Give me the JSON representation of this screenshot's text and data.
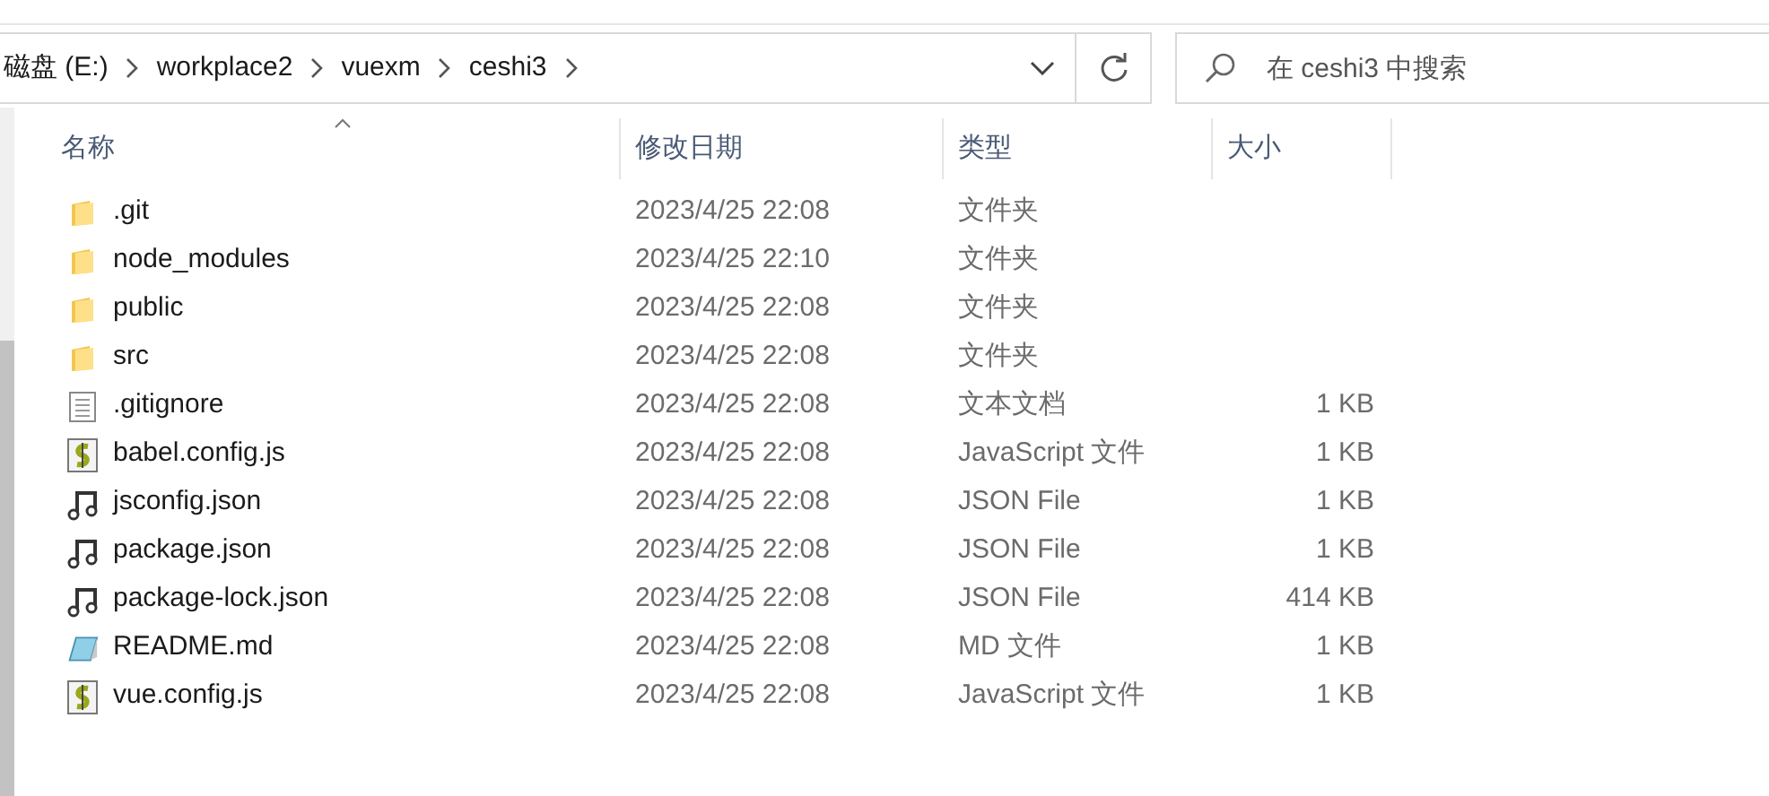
{
  "address_bar": {
    "segments": [
      "磁盘 (E:)",
      "workplace2",
      "vuexm",
      "ceshi3"
    ]
  },
  "search": {
    "placeholder": "在 ceshi3 中搜索"
  },
  "columns": [
    {
      "label": "名称",
      "sorted": true
    },
    {
      "label": "修改日期",
      "sorted": false
    },
    {
      "label": "类型",
      "sorted": false
    },
    {
      "label": "大小",
      "sorted": false
    }
  ],
  "files": [
    {
      "kind": "folder",
      "name": ".git",
      "modified": "2023/4/25 22:08",
      "type": "文件夹"
    },
    {
      "kind": "folder",
      "name": "node_modules",
      "modified": "2023/4/25 22:10",
      "type": "文件夹"
    },
    {
      "kind": "folder",
      "name": "public",
      "modified": "2023/4/25 22:08",
      "type": "文件夹"
    },
    {
      "kind": "folder",
      "name": "src",
      "modified": "2023/4/25 22:08",
      "type": "文件夹"
    },
    {
      "kind": "text",
      "name": ".gitignore",
      "modified": "2023/4/25 22:08",
      "type": "文本文档",
      "size": "1 KB"
    },
    {
      "kind": "script",
      "name": "babel.config.js",
      "modified": "2023/4/25 22:08",
      "type": "JavaScript 文件",
      "size": "1 KB"
    },
    {
      "kind": "json",
      "name": "jsconfig.json",
      "modified": "2023/4/25 22:08",
      "type": "JSON File",
      "size": "1 KB"
    },
    {
      "kind": "json",
      "name": "package.json",
      "modified": "2023/4/25 22:08",
      "type": "JSON File",
      "size": "1 KB"
    },
    {
      "kind": "json",
      "name": "package-lock.json",
      "modified": "2023/4/25 22:08",
      "type": "JSON File",
      "size": "414 KB"
    },
    {
      "kind": "markdown",
      "name": "README.md",
      "modified": "2023/4/25 22:08",
      "type": "MD 文件",
      "size": "1 KB"
    },
    {
      "kind": "script",
      "name": "vue.config.js",
      "modified": "2023/4/25 22:08",
      "type": "JavaScript 文件",
      "size": "1 KB"
    }
  ]
}
